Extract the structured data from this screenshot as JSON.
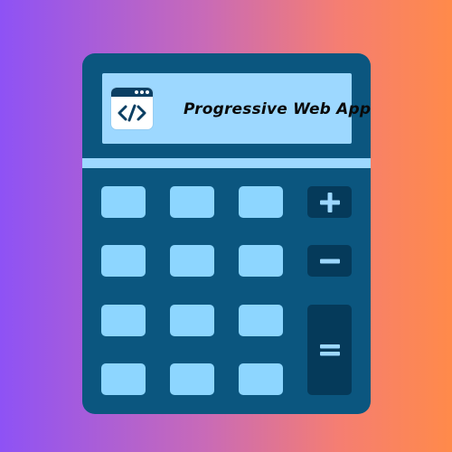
{
  "screen": {
    "title": "Progressive Web App.",
    "icon": "code-window-icon"
  },
  "keypad": {
    "digit_keys": 12,
    "operators": [
      {
        "name": "plus",
        "symbol": "+"
      },
      {
        "name": "minus",
        "symbol": "−"
      },
      {
        "name": "equals",
        "symbol": "="
      }
    ]
  },
  "colors": {
    "background_gradient": [
      "#8e52f5",
      "#c86ab8",
      "#f57e72",
      "#ff8a4a"
    ],
    "calculator_body": "#0b567f",
    "screen": "#9dd8ff",
    "keys": "#8dd6ff",
    "operator_keys": "#053a5a",
    "operator_symbols": "#9dd8ff"
  }
}
